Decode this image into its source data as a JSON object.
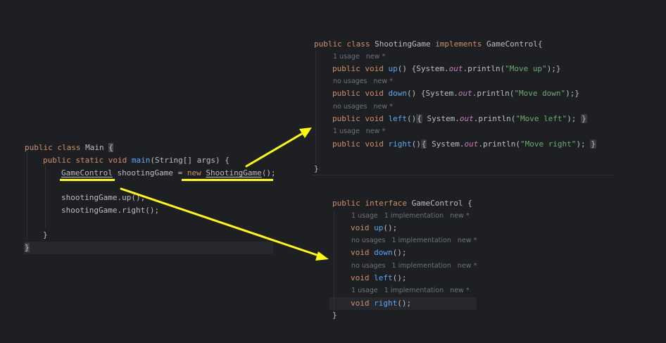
{
  "main_snippet": {
    "lines": [
      {
        "a": "public class ",
        "b": "Main ",
        "c": "{"
      },
      {
        "kw": "public static void ",
        "fn": "main",
        "rest": "(String[] args) {"
      },
      {
        "type": "GameControl",
        "var": " shootingGame = ",
        "kw": "new",
        "sp": " ",
        "cls": "ShootingGame",
        "end": "();"
      },
      {
        "text": "shootingGame.up();"
      },
      {
        "text": "shootingGame.right();"
      },
      {
        "text": "}"
      },
      {
        "text": "}"
      }
    ]
  },
  "shooting_snippet": {
    "header": {
      "kw": "public class ",
      "name": "ShootingGame ",
      "kw2": "implements",
      "rest": " GameControl{"
    },
    "methods": [
      {
        "hint": "1 usage   new *",
        "kw": "public void ",
        "name": "up",
        "open": "() {System.",
        "field": "out",
        "call": ".println(",
        "str": "\"Move up\"",
        "close": ");}"
      },
      {
        "hint": "no usages   new *",
        "kw": "public void ",
        "name": "down",
        "open": "() {System.",
        "field": "out",
        "call": ".println(",
        "str": "\"Move down\"",
        "close": ");}"
      },
      {
        "hint": "no usages   new *",
        "kw": "public void ",
        "name": "left",
        "open": "()",
        "fold_open": "{",
        "mid": " System.",
        "field": "out",
        "call": ".println(",
        "str": "\"Move left\"",
        "close": ");",
        "fold_close": "}"
      },
      {
        "hint": "1 usage   new *",
        "kw": "public void ",
        "name": "right",
        "open": "()",
        "fold_open": "{",
        "mid": " System.",
        "field": "out",
        "call": ".println(",
        "str": "\"Move right\"",
        "close": ");",
        "fold_close": "}"
      }
    ],
    "closing": "}"
  },
  "interface_snippet": {
    "header": {
      "kw": "public interface ",
      "rest": "GameControl {"
    },
    "methods": [
      {
        "hint": "1 usage   1 implementation   new *",
        "kw": "void ",
        "name": "up",
        "end": "();"
      },
      {
        "hint": "no usages   1 implementation   new *",
        "kw": "void ",
        "name": "down",
        "end": "();"
      },
      {
        "hint": "no usages   1 implementation   new *",
        "kw": "void ",
        "name": "left",
        "end": "();"
      },
      {
        "hint": "1 usage   1 implementation   new *",
        "kw": "void ",
        "name": "right",
        "end": "();"
      }
    ],
    "closing": "}"
  },
  "colors": {
    "background": "#1e1f22",
    "keyword": "#cf8e6d",
    "method": "#56a8f5",
    "string": "#6aab73",
    "field": "#c77dbb",
    "text": "#bcbec4",
    "hint": "#6f737a",
    "annotation": "#ffff00"
  }
}
